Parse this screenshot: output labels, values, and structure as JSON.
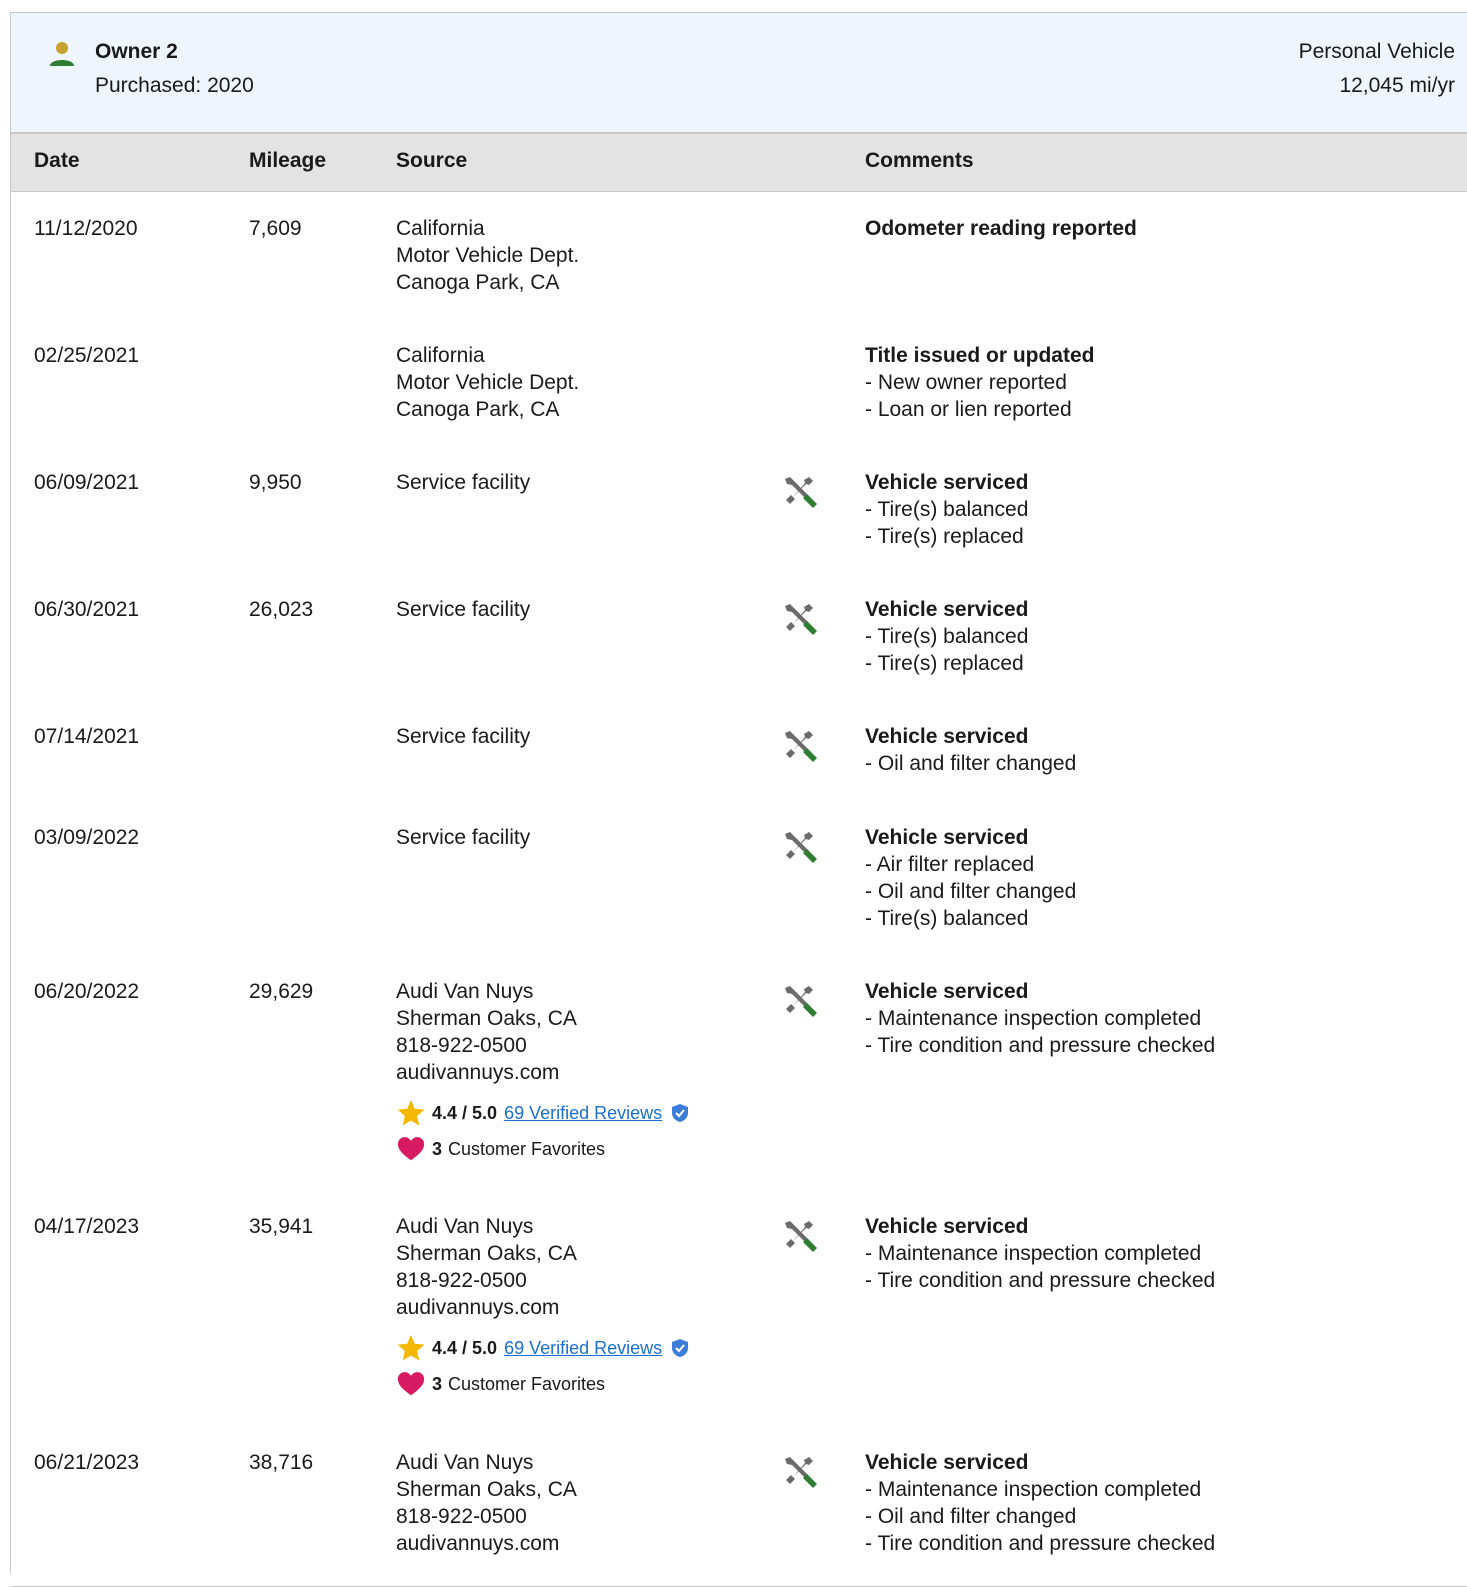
{
  "owner": {
    "name": "Owner 2",
    "purchased": "Purchased: 2020",
    "vehicle_type": "Personal Vehicle",
    "mileage_per_year": "12,045 mi/yr"
  },
  "table": {
    "headers": {
      "date": "Date",
      "mileage": "Mileage",
      "source": "Source",
      "comments": "Comments"
    },
    "rows": [
      {
        "date": "11/12/2020",
        "mileage": "7,609",
        "source": [
          "California",
          "Motor Vehicle Dept.",
          "Canoga Park, CA"
        ],
        "comment_title": "Odometer reading reported",
        "comment_items": []
      },
      {
        "date": "02/25/2021",
        "mileage": "",
        "source": [
          "California",
          "Motor Vehicle Dept.",
          "Canoga Park, CA"
        ],
        "comment_title": "Title issued or updated",
        "comment_items": [
          "- New owner reported",
          "- Loan or lien reported"
        ]
      },
      {
        "date": "06/09/2021",
        "mileage": "9,950",
        "source": [
          "Service facility"
        ],
        "service_icon": "wrench-screwdriver-icon",
        "comment_title": "Vehicle serviced",
        "comment_items": [
          "- Tire(s) balanced",
          "- Tire(s) replaced"
        ]
      },
      {
        "date": "06/30/2021",
        "mileage": "26,023",
        "source": [
          "Service facility"
        ],
        "service_icon": "wrench-screwdriver-icon",
        "comment_title": "Vehicle serviced",
        "comment_items": [
          "- Tire(s) balanced",
          "- Tire(s) replaced"
        ]
      },
      {
        "date": "07/14/2021",
        "mileage": "",
        "source": [
          "Service facility"
        ],
        "service_icon": "wrench-screwdriver-icon",
        "comment_title": "Vehicle serviced",
        "comment_items": [
          "- Oil and filter changed"
        ]
      },
      {
        "date": "03/09/2022",
        "mileage": "",
        "source": [
          "Service facility"
        ],
        "service_icon": "wrench-screwdriver-icon",
        "comment_title": "Vehicle serviced",
        "comment_items": [
          "- Air filter replaced",
          "- Oil and filter changed",
          "- Tire(s) balanced"
        ]
      },
      {
        "date": "06/20/2022",
        "mileage": "29,629",
        "source": [
          "Audi Van Nuys",
          "Sherman Oaks, CA",
          "818-922-0500",
          "audivannuys.com"
        ],
        "rating": {
          "value": "4.4 / 5.0",
          "reviews": "69 Verified Reviews"
        },
        "favorites": {
          "count": "3",
          "label": "Customer Favorites"
        },
        "service_icon": "wrench-screwdriver-icon",
        "comment_title": "Vehicle serviced",
        "comment_items": [
          "- Maintenance inspection completed",
          "- Tire condition and pressure checked"
        ]
      },
      {
        "date": "04/17/2023",
        "mileage": "35,941",
        "source": [
          "Audi Van Nuys",
          "Sherman Oaks, CA",
          "818-922-0500",
          "audivannuys.com"
        ],
        "rating": {
          "value": "4.4 / 5.0",
          "reviews": "69 Verified Reviews"
        },
        "favorites": {
          "count": "3",
          "label": "Customer Favorites"
        },
        "service_icon": "wrench-screwdriver-icon",
        "comment_title": "Vehicle serviced",
        "comment_items": [
          "- Maintenance inspection completed",
          "- Tire condition and pressure checked"
        ]
      },
      {
        "date": "06/21/2023",
        "mileage": "38,716",
        "source": [
          "Audi Van Nuys",
          "Sherman Oaks, CA",
          "818-922-0500",
          "audivannuys.com"
        ],
        "service_icon": "wrench-screwdriver-icon",
        "comment_title": "Vehicle serviced",
        "comment_items": [
          "- Maintenance inspection completed",
          "- Oil and filter changed",
          "- Tire condition and pressure checked"
        ]
      }
    ]
  },
  "colors": {
    "header_bg": "#eef5fc",
    "table_head_bg": "#e3e3e3",
    "icon_green": "#2e7d32",
    "icon_gray": "#6b6b6b",
    "owner_head": "#c8a02e",
    "link_blue": "#1a6fd1",
    "star": "#f5b800",
    "heart": "#d81b60"
  }
}
